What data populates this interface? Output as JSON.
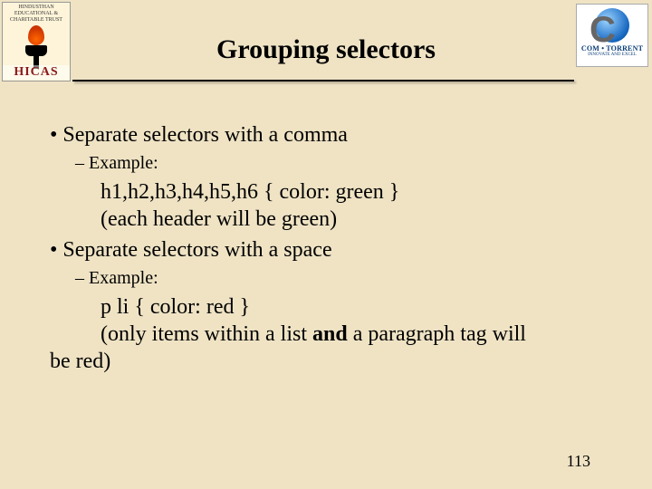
{
  "header": {
    "title": "Grouping selectors",
    "logo_left": {
      "line1": "HINDUSTHAN",
      "line2": "EDUCATIONAL &",
      "line3": "CHARITABLE TRUST",
      "bottom": "HICAS"
    },
    "logo_right": {
      "label": "COM • TORRENT",
      "sub": "INNOVATE AND EXCEL"
    }
  },
  "bullets": {
    "b1a": "Separate selectors with a comma",
    "b2a": "Example:",
    "ex1_line1": "h1,h2,h3,h4,h5,h6 { color: green }",
    "ex1_line2": "(each header will be green)",
    "b1b": "Separate selectors with a space",
    "b2b": "Example:",
    "ex2_line1": "p li { color: red }",
    "ex2_pre": "(only items within a list ",
    "ex2_bold": "and",
    "ex2_post": " a   paragraph tag will",
    "ex2_cont": "be red)"
  },
  "page": "113"
}
